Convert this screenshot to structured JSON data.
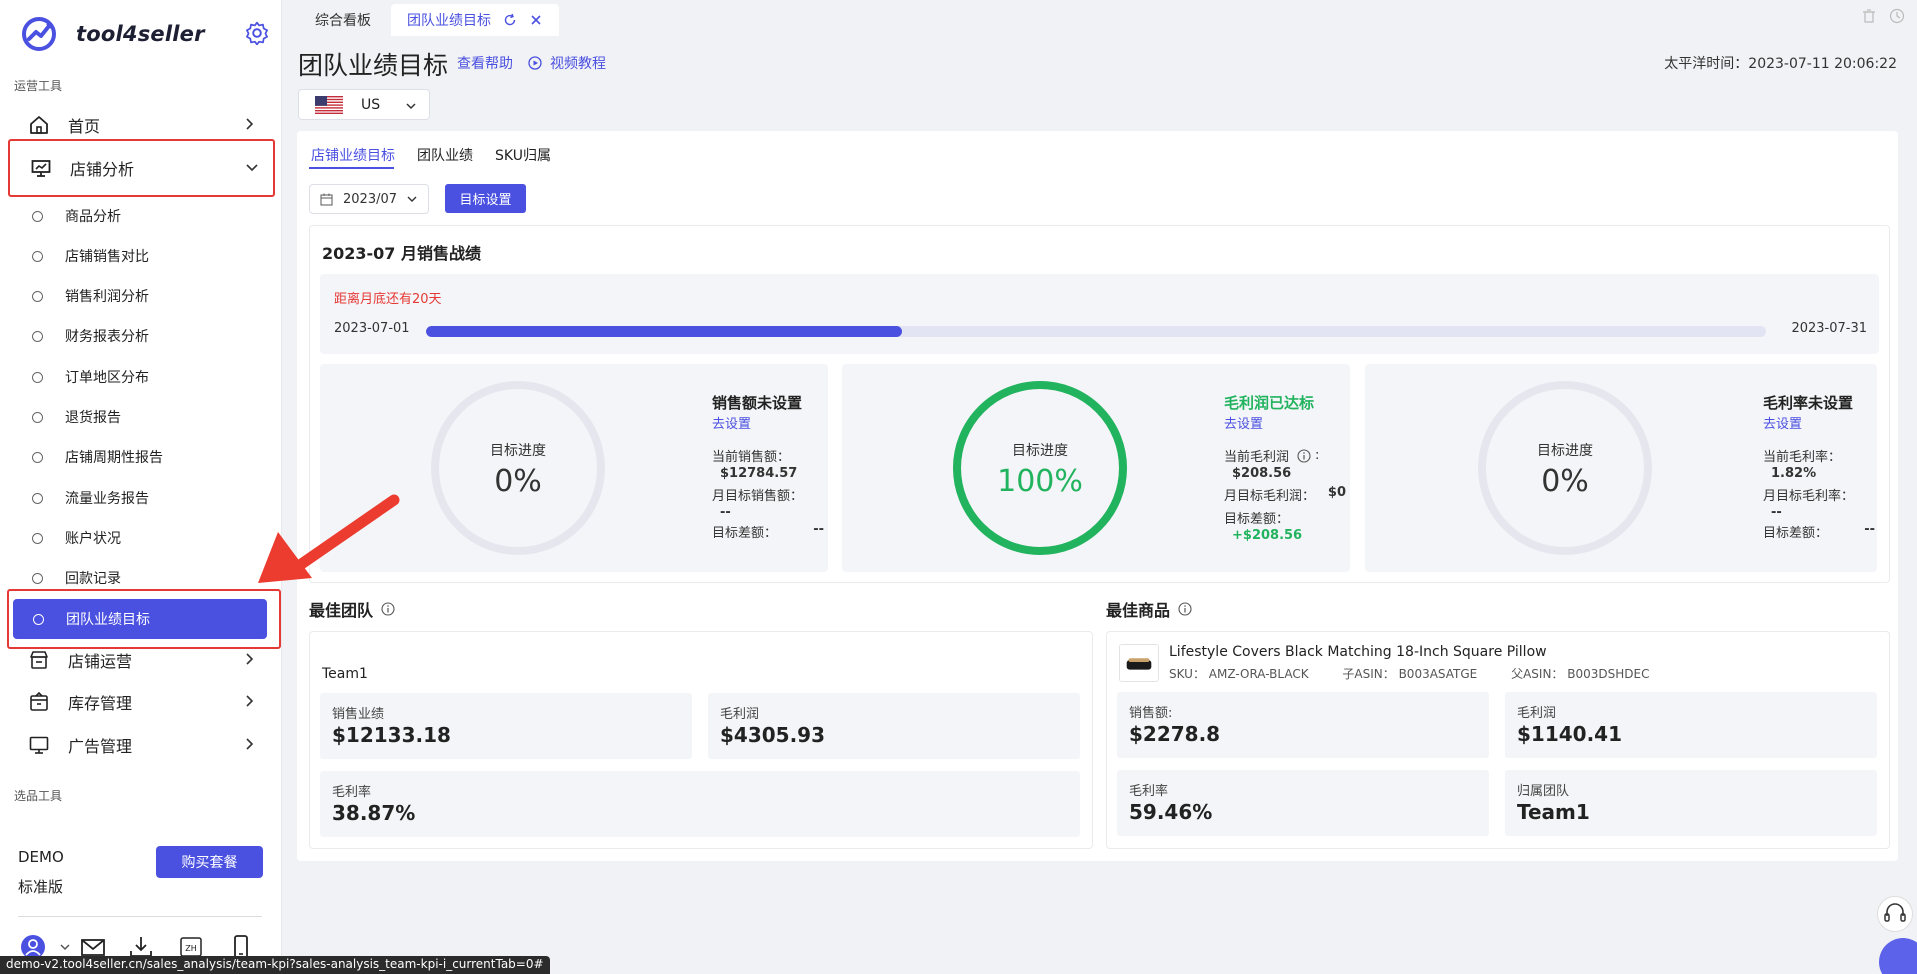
{
  "app": {
    "name": "tool4seller"
  },
  "sidebar": {
    "section_ops": "运营工具",
    "section_select": "选品工具",
    "items": [
      {
        "label": "首页"
      },
      {
        "label": "店铺分析"
      },
      {
        "label": "店铺运营"
      },
      {
        "label": "库存管理"
      },
      {
        "label": "广告管理"
      }
    ],
    "sub_items": [
      {
        "label": "商品分析"
      },
      {
        "label": "店铺销售对比"
      },
      {
        "label": "销售利润分析"
      },
      {
        "label": "财务报表分析"
      },
      {
        "label": "订单地区分布"
      },
      {
        "label": "退货报告"
      },
      {
        "label": "店铺周期性报告"
      },
      {
        "label": "流量业务报告"
      },
      {
        "label": "账户状况"
      },
      {
        "label": "回款记录"
      },
      {
        "label": "团队业绩目标"
      }
    ],
    "account": {
      "demo": "DEMO",
      "edition": "标准版",
      "buy_label": "购买套餐"
    }
  },
  "tabs": [
    {
      "label": "综合看板"
    },
    {
      "label": "团队业绩目标"
    }
  ],
  "header": {
    "title": "团队业绩目标",
    "help": "查看帮助",
    "video": "视频教程",
    "clock": "太平洋时间：2023-07-11 20:06:22",
    "country": "US"
  },
  "inner_tabs": [
    {
      "label": "店铺业绩目标"
    },
    {
      "label": "团队业绩"
    },
    {
      "label": "SKU归属"
    }
  ],
  "toolbar": {
    "month": "2023/07",
    "target_button": "目标设置"
  },
  "battle": {
    "title": "2023-07 月销售战绩",
    "countdown": "距离月底还有20天",
    "start": "2023-07-01",
    "end": "2023-07-31",
    "progress": 0.355
  },
  "kpis": [
    {
      "ring_label": "目标进度",
      "ring_value": "0%",
      "progress": 0,
      "status": "销售额未设置",
      "set_link": "去设置",
      "l1": "当前销售额：",
      "v1": "$12784.57",
      "l2": "月目标销售额：",
      "v2": "--",
      "l3": "目标差额：",
      "v3": "--"
    },
    {
      "ring_label": "目标进度",
      "ring_value": "100%",
      "progress": 1,
      "status": "毛利润已达标",
      "set_link": "去设置",
      "l1": "当前毛利润",
      "v1": "$208.56",
      "l2": "月目标毛利润：",
      "v2": "$0",
      "l3": "目标差额：",
      "v3": "+$208.56"
    },
    {
      "ring_label": "目标进度",
      "ring_value": "0%",
      "progress": 0,
      "status": "毛利率未设置",
      "set_link": "去设置",
      "l1": "当前毛利率：",
      "v1": "1.82%",
      "l2": "月目标毛利率：",
      "v2": "--",
      "l3": "目标差额：",
      "v3": "--"
    }
  ],
  "best_team": {
    "title": "最佳团队",
    "name": "Team1",
    "metrics": [
      {
        "label": "销售业绩",
        "value": "$12133.18"
      },
      {
        "label": "毛利润",
        "value": "$4305.93"
      },
      {
        "label": "毛利率",
        "value": "38.87%"
      }
    ]
  },
  "best_product": {
    "title": "最佳商品",
    "name": "Lifestyle Covers Black Matching 18-Inch Square Pillow",
    "sku": "SKU： AMZ-ORA-BLACK",
    "child_asin": "子ASIN： B003ASATGE",
    "parent_asin": "父ASIN： B003DSHDEC",
    "metrics": [
      {
        "label": "销售额:",
        "value": "$2278.8"
      },
      {
        "label": "毛利润",
        "value": "$1140.41"
      },
      {
        "label": "毛利率",
        "value": "59.46%"
      },
      {
        "label": "归属团队",
        "value": "Team1"
      }
    ]
  },
  "status_url": "demo-v2.tool4seller.cn/sales_analysis/team-kpi?sales-analysis_team-kpi-i_currentTab=0#",
  "colors": {
    "accent": "#4a50e0",
    "success": "#22b35e",
    "danger": "#e53935"
  }
}
